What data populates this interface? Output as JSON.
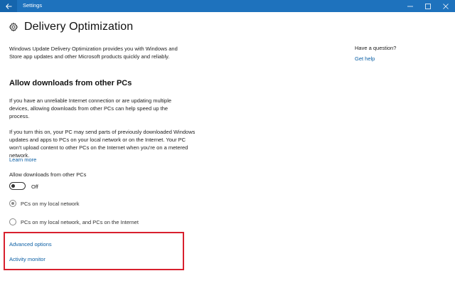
{
  "window": {
    "title": "Settings",
    "controls": {
      "minimize": "—",
      "maximize": "☐",
      "close": "✕"
    }
  },
  "page": {
    "title": "Delivery Optimization",
    "intro": "Windows Update Delivery Optimization provides you with Windows and Store app updates and other Microsoft products quickly and reliably.",
    "section_title": "Allow downloads from other PCs",
    "para_unreliable": "If you have an unreliable Internet connection or are updating multiple devices, allowing downloads from other PCs can help speed up the process.",
    "para_turn_on": "If you turn this on, your PC may send parts of previously downloaded Windows updates and apps to PCs on your local network or on the Internet. Your PC won't upload content to other PCs on the Internet when you're on a metered network.",
    "learn_more": "Learn more",
    "toggle": {
      "label": "Allow downloads from other PCs",
      "state": "Off",
      "on": false
    },
    "radio_options": [
      {
        "label": "PCs on my local network",
        "selected": true
      },
      {
        "label": "PCs on my local network, and PCs on the Internet",
        "selected": false
      }
    ],
    "links": {
      "advanced_options": "Advanced options",
      "activity_monitor": "Activity monitor"
    }
  },
  "sidebar": {
    "question": "Have a question?",
    "get_help": "Get help"
  },
  "colors": {
    "titlebar": "#1e72bd",
    "link": "#0b5fa5",
    "highlight_box": "#d8202e"
  },
  "icons": {
    "back": "back-arrow-icon",
    "header": "gear-icon"
  }
}
